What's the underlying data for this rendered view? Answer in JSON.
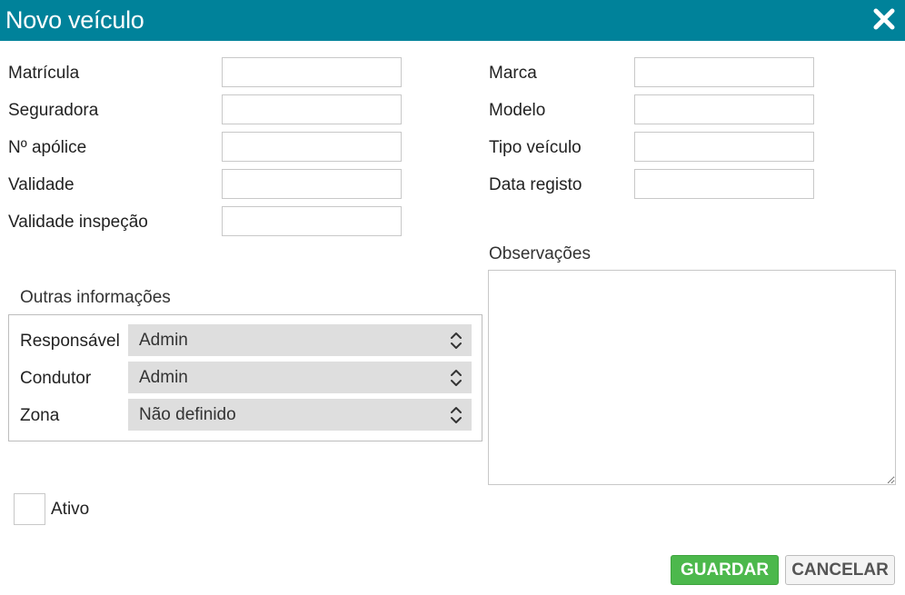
{
  "dialog": {
    "title": "Novo veículo",
    "close_icon": "close-icon"
  },
  "left_fields": [
    {
      "label": "Matrícula",
      "value": ""
    },
    {
      "label": "Seguradora",
      "value": ""
    },
    {
      "label": "Nº apólice",
      "value": ""
    },
    {
      "label": "Validade",
      "value": ""
    },
    {
      "label": "Validade inspeção",
      "value": ""
    }
  ],
  "right_fields": [
    {
      "label": "Marca",
      "value": ""
    },
    {
      "label": "Modelo",
      "value": ""
    },
    {
      "label": "Tipo veículo",
      "value": ""
    },
    {
      "label": "Data registo",
      "value": ""
    }
  ],
  "observations": {
    "label": "Observações",
    "value": ""
  },
  "other_info": {
    "legend": "Outras informações",
    "selects": [
      {
        "label": "Responsável",
        "value": "Admin"
      },
      {
        "label": "Condutor",
        "value": "Admin"
      },
      {
        "label": "Zona",
        "value": "Não definido"
      }
    ]
  },
  "active": {
    "label": "Ativo",
    "checked": false
  },
  "buttons": {
    "save": "GUARDAR",
    "cancel": "CANCELAR"
  },
  "colors": {
    "header": "#00829a",
    "save": "#4cb84c",
    "select_bg": "#dedede"
  }
}
